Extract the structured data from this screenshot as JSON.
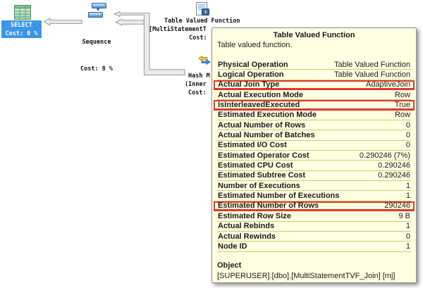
{
  "plan": {
    "select_node": {
      "label": "SELECT",
      "cost": "Cost: 0 %"
    },
    "sequence_node": {
      "label": "Sequence",
      "cost": "Cost: 8 %"
    },
    "tvf_node": {
      "line1": "Table Valued Function",
      "line2": "[MultiStatementT",
      "line3": "Cost:"
    },
    "hash_node": {
      "line1": "Hash M",
      "line2": "(Inner",
      "line3": "Cost:"
    }
  },
  "tooltip": {
    "title": "Table Valued Function",
    "description": "Table valued function.",
    "rows": [
      {
        "label": "Physical Operation",
        "value": "Table Valued Function",
        "highlight": false
      },
      {
        "label": "Logical Operation",
        "value": "Table Valued Function",
        "highlight": false
      },
      {
        "label": "Actual Join Type",
        "value": "AdaptiveJoin",
        "highlight": true
      },
      {
        "label": "Actual Execution Mode",
        "value": "Row",
        "highlight": false
      },
      {
        "label": "IsInterleavedExecuted",
        "value": "True",
        "highlight": true
      },
      {
        "label": "Estimated Execution Mode",
        "value": "Row",
        "highlight": false
      },
      {
        "label": "Actual Number of Rows",
        "value": "0",
        "highlight": false
      },
      {
        "label": "Actual Number of Batches",
        "value": "0",
        "highlight": false
      },
      {
        "label": "Estimated I/O Cost",
        "value": "0",
        "highlight": false
      },
      {
        "label": "Estimated Operator Cost",
        "value": "0.290246 (7%)",
        "highlight": false
      },
      {
        "label": "Estimated CPU Cost",
        "value": "0.290246",
        "highlight": false
      },
      {
        "label": "Estimated Subtree Cost",
        "value": "0.290246",
        "highlight": false
      },
      {
        "label": "Number of Executions",
        "value": "1",
        "highlight": false
      },
      {
        "label": "Estimated Number of Executions",
        "value": "1",
        "highlight": false
      },
      {
        "label": "Estimated Number of Rows",
        "value": "290246",
        "highlight": true
      },
      {
        "label": "Estimated Row Size",
        "value": "9 B",
        "highlight": false
      },
      {
        "label": "Actual Rebinds",
        "value": "1",
        "highlight": false
      },
      {
        "label": "Actual Rewinds",
        "value": "0",
        "highlight": false
      },
      {
        "label": "Node ID",
        "value": "1",
        "highlight": false
      }
    ],
    "object_label": "Object",
    "object_value": "[SUPERUSER].[dbo].[MultiStatementTVF_Join] [mj]"
  },
  "colors": {
    "highlight_red": "#e0382c",
    "tooltip_bg": "#ffffe1",
    "selection_blue": "#3c95e9",
    "row_separator": "#cfca7d",
    "arrow_fill": "#ebebeb",
    "arrow_stroke": "#9b9b9b"
  }
}
